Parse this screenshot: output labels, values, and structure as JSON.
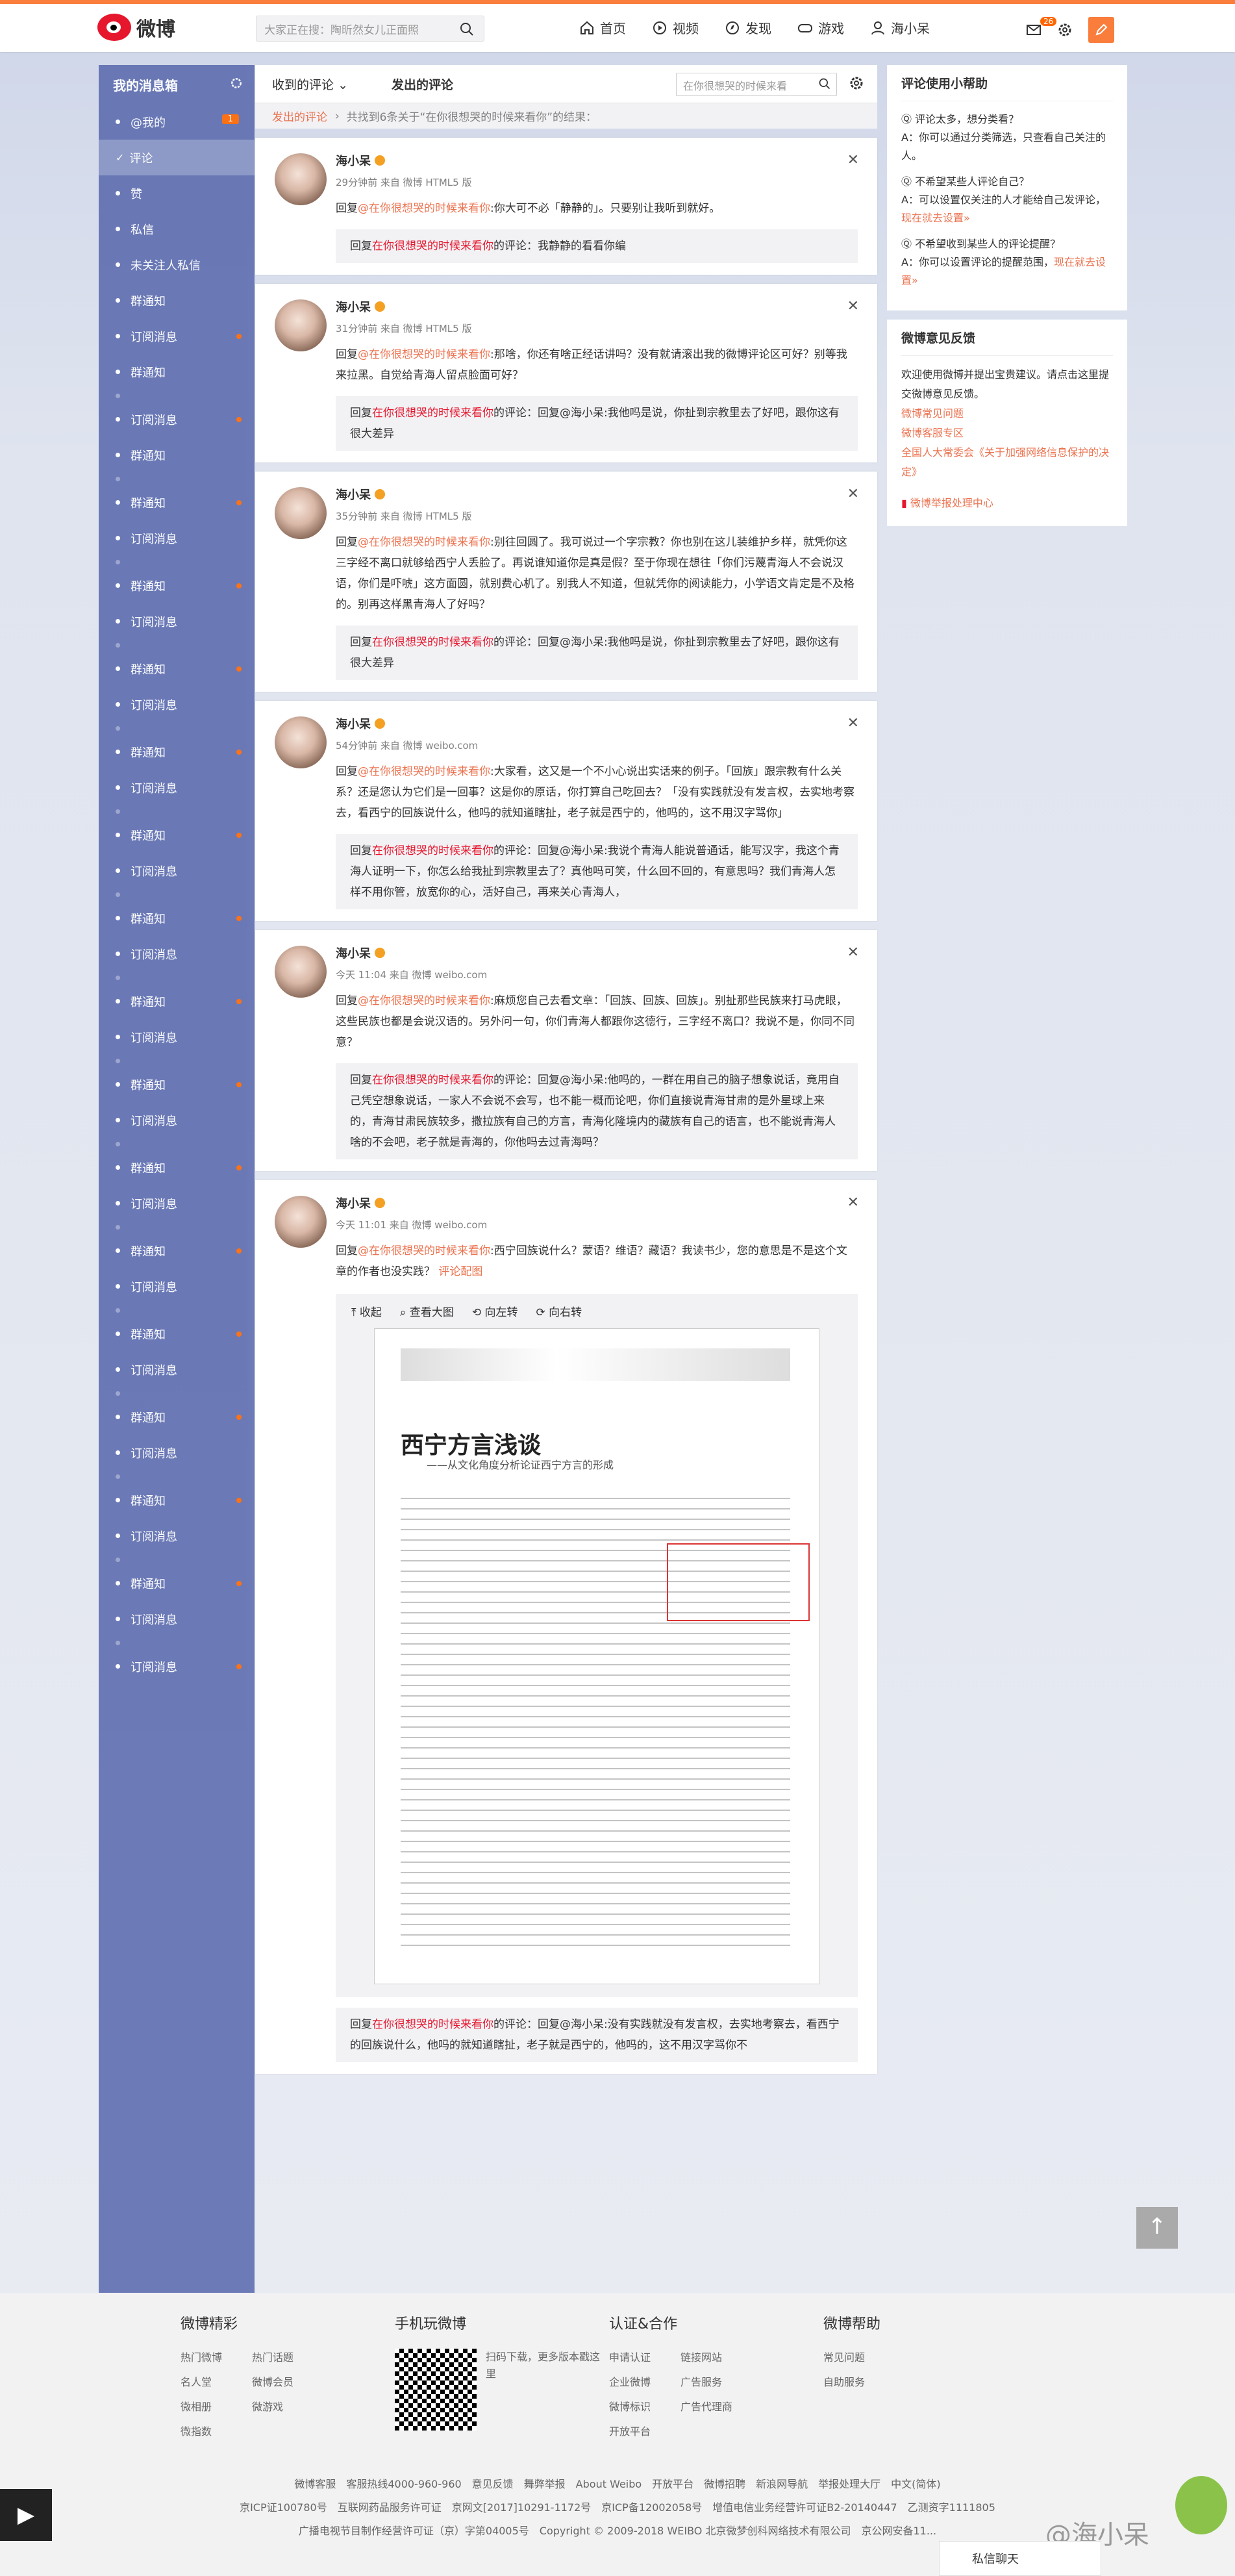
{
  "header": {
    "logo": "微博",
    "search_placeholder": "大家正在搜：陶昕然女儿正面照",
    "nav": [
      "首页",
      "视频",
      "发现",
      "游戏",
      "海小呆"
    ],
    "msg_count": "26"
  },
  "sidebar": {
    "title": "我的消息箱",
    "items": [
      {
        "label": "@我的",
        "badge": "1"
      },
      {
        "label": "评论",
        "active": true
      },
      {
        "label": "赞"
      },
      {
        "label": "私信"
      },
      {
        "label": "未关注人私信"
      },
      {
        "label": "群通知"
      },
      {
        "label": "订阅消息",
        "dot": true
      },
      {
        "label": "群通知"
      },
      {
        "label": "订阅消息"
      },
      {
        "label": "群通知"
      },
      {
        "label": "群通知"
      },
      {
        "label": "订阅消息"
      },
      {
        "label": "群通知"
      },
      {
        "label": "订阅消息"
      },
      {
        "label": "群通知"
      },
      {
        "label": "订阅消息"
      },
      {
        "label": "群通知"
      },
      {
        "label": "订阅消息"
      },
      {
        "label": "群通知"
      },
      {
        "label": "订阅消息"
      },
      {
        "label": "群通知"
      },
      {
        "label": "订阅消息"
      },
      {
        "label": "群通知"
      },
      {
        "label": "订阅消息"
      },
      {
        "label": "群通知"
      },
      {
        "label": "订阅消息"
      },
      {
        "label": "群通知"
      },
      {
        "label": "订阅消息"
      },
      {
        "label": "群通知"
      },
      {
        "label": "订阅消息"
      },
      {
        "label": "群通知"
      },
      {
        "label": "订阅消息"
      },
      {
        "label": "群通知"
      },
      {
        "label": "订阅消息"
      },
      {
        "label": "群通知"
      },
      {
        "label": "订阅消息"
      },
      {
        "label": "群通知"
      },
      {
        "label": "订阅消息"
      },
      {
        "label": "订阅消息"
      }
    ]
  },
  "main": {
    "tab_received": "收到的评论",
    "tab_sent": "发出的评论",
    "search_placeholder": "在你很想哭的时候来看",
    "crumb_link": "发出的评论",
    "crumb_text": "共找到6条关于“在你很想哭的时候来看你”的结果："
  },
  "cards": [
    {
      "name": "海小呆",
      "meta": "29分钟前 来自 微博 HTML5 版",
      "text_pre": "回复",
      "at": "@在你很想哭的时候来看你",
      "text": ":你大可不必「静静的」。只要别让我听到就好。",
      "quote_pre": "回复",
      "quote_at": "在你很想哭的时候来看你",
      "quote": "的评论：我静静的看看你编"
    },
    {
      "name": "海小呆",
      "meta": "31分钟前 来自 微博 HTML5 版",
      "text_pre": "回复",
      "at": "@在你很想哭的时候来看你",
      "text": ":那啥，你还有啥正经话讲吗？没有就请滚出我的微博评论区可好？别等我来拉黑。自觉给青海人留点脸面可好？",
      "quote_pre": "回复",
      "quote_at": "在你很想哭的时候来看你",
      "quote": "的评论：回复@海小呆:我他吗是说，你扯到宗教里去了好吧，跟你这有很大差异"
    },
    {
      "name": "海小呆",
      "meta": "35分钟前 来自 微博 HTML5 版",
      "text_pre": "回复",
      "at": "@在你很想哭的时候来看你",
      "text": ":别往回圆了。我可说过一个字宗教？你也别在这儿装维护乡样，就凭你这三字经不离口就够给西宁人丢脸了。再说谁知道你是真是假？至于你现在想往「你们污蔑青海人不会说汉语，你们是吓唬」这方面圆，就别费心机了。别我人不知道，但就凭你的阅读能力，小学语文肯定是不及格的。别再这样黑青海人了好吗？",
      "quote_pre": "回复",
      "quote_at": "在你很想哭的时候来看你",
      "quote": "的评论：回复@海小呆:我他吗是说，你扯到宗教里去了好吧，跟你这有很大差异"
    },
    {
      "name": "海小呆",
      "meta": "54分钟前 来自 微博 weibo.com",
      "text_pre": "回复",
      "at": "@在你很想哭的时候来看你",
      "text": ":大家看，这又是一个不小心说出实话来的例子。「回族」跟宗教有什么关系？还是您认为它们是一回事？这是你的原话，你打算自己吃回去？「没有实践就没有发言权，去实地考察去，看西宁的回族说什么，他吗的就知道瞎扯，老子就是西宁的，他吗的，这不用汉字骂你」",
      "quote_pre": "回复",
      "quote_at": "在你很想哭的时候来看你",
      "quote": "的评论：回复@海小呆:我说个青海人能说普通话，能写汉字，我这个青海人证明一下，你怎么给我扯到宗教里去了？真他吗可笑，什么回不回的，有意思吗？我们青海人怎样不用你管，放宽你的心，活好自己，再来关心青海人，"
    },
    {
      "name": "海小呆",
      "meta": "今天 11:04 来自 微博 weibo.com",
      "text_pre": "回复",
      "at": "@在你很想哭的时候来看你",
      "text": ":麻烦您自己去看文章：「回族、回族、回族」。别扯那些民族来打马虎眼，这些民族也都是会说汉语的。另外问一句，你们青海人都跟你这德行，三字经不离口？我说不是，你同不同意？",
      "quote_pre": "回复",
      "quote_at": "在你很想哭的时候来看你",
      "quote": "的评论：回复@海小呆:他吗的，一群在用自己的脑子想象说话，竟用自己凭空想象说话，一家人不会说不会写，也不能一概而论吧，你们直接说青海甘肃的是外星球上来的，青海甘肃民族较多，撒拉族有自己的方言，青海化隆境内的藏族有自己的语言，也不能说青海人啥的不会吧，老子就是青海的，你他吗去过青海吗？"
    },
    {
      "name": "海小呆",
      "meta": "今天 11:01 来自 微博 weibo.com",
      "text_pre": "回复",
      "at": "@在你很想哭的时候来看你",
      "text": ":西宁回族说什么？蒙语？维语？藏语？我读书少，您的意思是不是这个文章的作者也没实践？",
      "link": "评论配图",
      "tools": [
        "收起",
        "查看大图",
        "向左转",
        "向右转"
      ],
      "scan_title": "西宁方言浅谈",
      "scan_sub": "——从文化角度分析论证西宁方言的形成",
      "quote_pre": "回复",
      "quote_at": "在你很想哭的时候来看你",
      "quote": "的评论：回复@海小呆:没有实践就没有发言权，去实地考察去，看西宁的回族说什么，他吗的就知道瞎扯，老子就是西宁的，他吗的，这不用汉字骂你不"
    }
  ],
  "help": {
    "title": "评论使用小帮助",
    "qa": [
      {
        "q": "评论太多，想分类看？",
        "a": "A：你可以通过分类筛选，只查看自己关注的人。"
      },
      {
        "q": "不希望某些人评论自己？",
        "a": "A：可以设置仅关注的人才能给自己发评论，",
        "link": "现在就去设置»"
      },
      {
        "q": "不希望收到某些人的评论提醒？",
        "a": "A：你可以设置评论的提醒范围，",
        "link": "现在就去设置»"
      }
    ]
  },
  "feedback": {
    "title": "微博意见反馈",
    "text": "欢迎使用微博并提出宝贵建议。请点击这里提交微博意见反馈。",
    "links": [
      "微博常见问题",
      "微博客服专区",
      "全国人大常委会《关于加强网络信息保护的决定》"
    ],
    "report": "微博举报处理中心"
  },
  "footer": {
    "cols": [
      {
        "title": "微博精彩",
        "links": [
          "热门微博",
          "热门话题",
          "名人堂",
          "微博会员",
          "微相册",
          "微游戏",
          "微指数"
        ]
      },
      {
        "title": "手机玩微博",
        "qr_text": "扫码下载，更多版本戳这里"
      },
      {
        "title": "认证&合作",
        "links": [
          "申请认证",
          "链接网站",
          "企业微博",
          "广告服务",
          "微博标识",
          "广告代理商",
          "开放平台"
        ]
      },
      {
        "title": "微博帮助",
        "links": [
          "常见问题",
          "自助服务"
        ]
      }
    ],
    "line1": "微博客服　客服热线4000-960-960　意见反馈　舞弊举报　About Weibo　开放平台　微博招聘　新浪网导航　举报处理大厅　中文(简体)",
    "line2": "京ICP证100780号　互联网药品服务许可证　京网文[2017]10291-1172号　京ICP备12002058号　增值电信业务经营许可证B2-20140447　乙测资字1111805",
    "line3": "广播电视节目制作经营许可证（京）字第04005号　Copyright © 2009-2018 WEIBO 北京微梦创科网络技术有限公司　京公网安备11...",
    "chat": "私信聊天",
    "watermark": "@海小呆"
  }
}
